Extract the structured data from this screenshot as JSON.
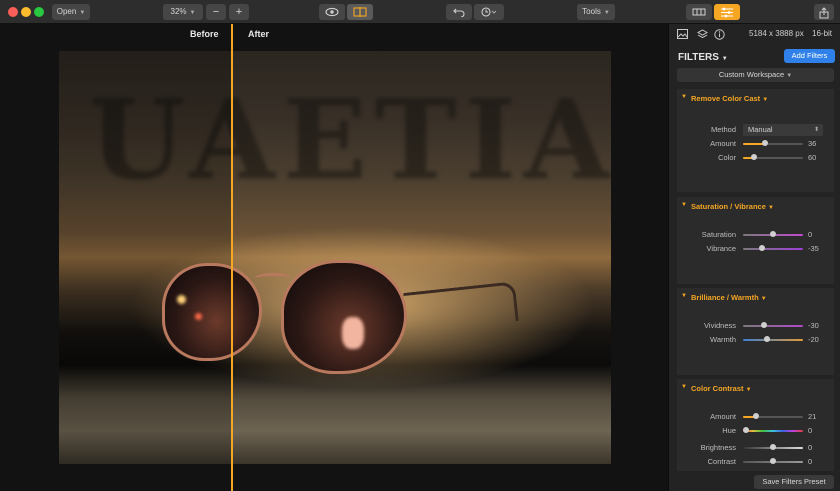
{
  "toolbar": {
    "open_label": "Open",
    "zoom_value": "32%",
    "zoom_out_label": "−",
    "zoom_in_label": "+",
    "tools_label": "Tools"
  },
  "canvas": {
    "before_label": "Before",
    "after_label": "After",
    "photo_text": "UAETIAI"
  },
  "panel": {
    "image_size": "5184 x 3888 px",
    "bit_depth": "16-bit",
    "filters_title": "FILTERS",
    "add_filters_label": "Add Filters",
    "workspace_label": "Custom Workspace",
    "save_preset_label": "Save Filters Preset",
    "sections": [
      {
        "title": "Remove Color Cast",
        "method_label": "Method",
        "method_value": "Manual",
        "rows": [
          {
            "label": "Amount",
            "value": "36"
          },
          {
            "label": "Color",
            "value": "60"
          }
        ]
      },
      {
        "title": "Saturation / Vibrance",
        "rows": [
          {
            "label": "Saturation",
            "value": "0"
          },
          {
            "label": "Vibrance",
            "value": "-35"
          }
        ]
      },
      {
        "title": "Brilliance / Warmth",
        "rows": [
          {
            "label": "Vividness",
            "value": "-30"
          },
          {
            "label": "Warmth",
            "value": "-20"
          }
        ]
      },
      {
        "title": "Color Contrast",
        "rows": [
          {
            "label": "Amount",
            "value": "21"
          },
          {
            "label": "Hue",
            "value": "0"
          },
          {
            "label": "Brightness",
            "value": "0"
          },
          {
            "label": "Contrast",
            "value": "0"
          }
        ]
      }
    ]
  },
  "colors": {
    "accent": "#f5a623",
    "primary_button": "#2f80e8",
    "close": "#fc5f57",
    "minimize": "#fdbc2e",
    "maximize": "#28c840"
  }
}
